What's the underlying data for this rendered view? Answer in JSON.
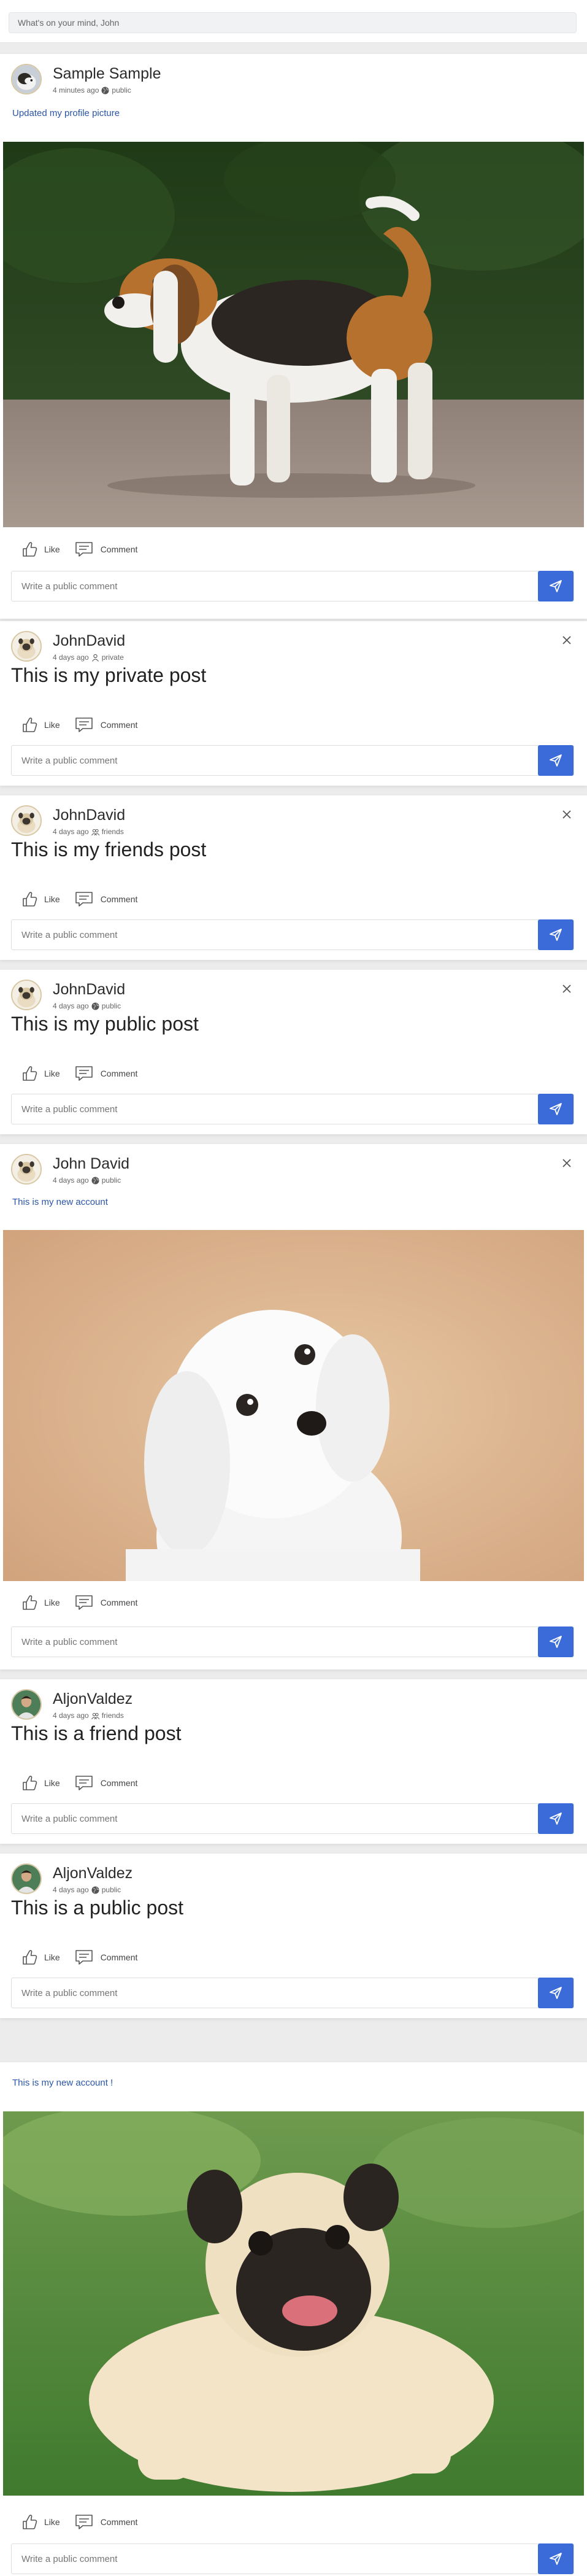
{
  "composer": {
    "placeholder": "What's on your mind, John"
  },
  "actions": {
    "like_label": "Like",
    "comment_label": "Comment"
  },
  "comment_placeholder": "Write a public comment",
  "colors": {
    "accent": "#3a6bd8",
    "link_text": "#2a55a8",
    "background": "#ececec"
  },
  "posts": [
    {
      "author": "Sample Sample",
      "time": "4 minutes ago",
      "privacy": "public",
      "privacy_icon": "globe-icon",
      "text": "Updated my profile picture",
      "image": "beagle-photo"
    },
    {
      "author": "JohnDavid",
      "time": "4 days ago",
      "privacy": "private",
      "privacy_icon": "person-icon",
      "text": "This is my private post"
    },
    {
      "author": "JohnDavid",
      "time": "4 days ago",
      "privacy": "friends",
      "privacy_icon": "people-icon",
      "text": "This is my friends post"
    },
    {
      "author": "JohnDavid",
      "time": "4 days ago",
      "privacy": "public",
      "privacy_icon": "globe-icon",
      "text": "This is my public post"
    },
    {
      "author": "John David",
      "time": "4 days ago",
      "privacy": "public",
      "privacy_icon": "globe-icon",
      "text": "This is my new account",
      "image": "maltese-photo"
    },
    {
      "author": "AljonValdez",
      "time": "4 days ago",
      "privacy": "friends",
      "privacy_icon": "people-icon",
      "text": "This is a friend post"
    },
    {
      "author": "AljonValdez",
      "time": "4 days ago",
      "privacy": "public",
      "privacy_icon": "globe-icon",
      "text": "This is a public post"
    },
    {
      "text": "This is my new account !",
      "image": "pug-photo"
    }
  ]
}
